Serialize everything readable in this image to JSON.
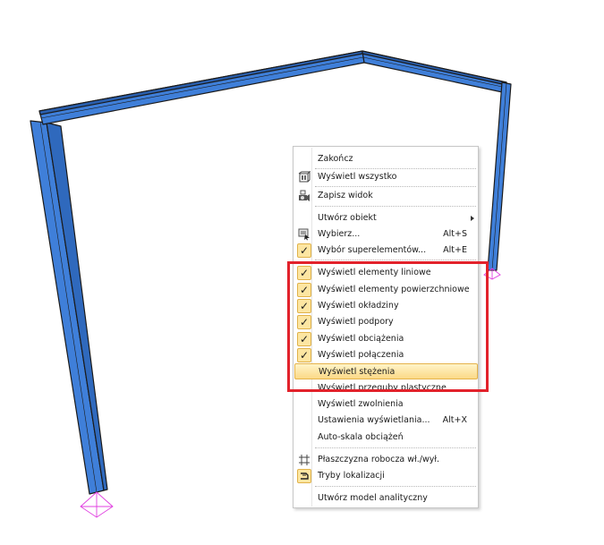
{
  "menu": {
    "items": [
      {
        "label": "Zakończ"
      },
      {
        "label": "Wyświetl wszystko",
        "icon": "view-all-icon"
      },
      {
        "label": "Zapisz widok",
        "icon": "camera-icon"
      },
      {
        "label": "Utwórz obiekt",
        "submenu": true
      },
      {
        "label": "Wybierz...",
        "shortcut": "Alt+S",
        "icon": "select-icon"
      },
      {
        "label": "Wybór superelementów...",
        "shortcut": "Alt+E",
        "checked": true
      },
      {
        "label": "Wyświetl elementy liniowe",
        "checked": true
      },
      {
        "label": "Wyświetl elementy powierzchniowe",
        "checked": true
      },
      {
        "label": "Wyświetl okładziny",
        "checked": true
      },
      {
        "label": "Wyświetl podpory",
        "checked": true
      },
      {
        "label": "Wyświetl obciążenia",
        "checked": true
      },
      {
        "label": "Wyświetl połączenia",
        "checked": true
      },
      {
        "label": "Wyświetl stężenia",
        "hover": true
      },
      {
        "label": "Wyświetl przeguby plastyczne"
      },
      {
        "label": "Wyświetl zwolnienia"
      },
      {
        "label": "Ustawienia wyświetlania...",
        "shortcut": "Alt+X"
      },
      {
        "label": "Auto-skala obciążeń"
      },
      {
        "label": "Płaszczyzna robocza wł./wył.",
        "icon": "grid-plane-icon"
      },
      {
        "label": "Tryby lokalizacji",
        "icon": "locate-mode-icon"
      },
      {
        "label": "Utwórz model analityczny"
      }
    ],
    "check_glyph": "✓"
  },
  "colors": {
    "beam": "#3f7fd9",
    "beam_edge": "#1b1b1b",
    "support": "#e040e0",
    "highlight": "#e2222b",
    "check_bg": "#fde6a2"
  }
}
